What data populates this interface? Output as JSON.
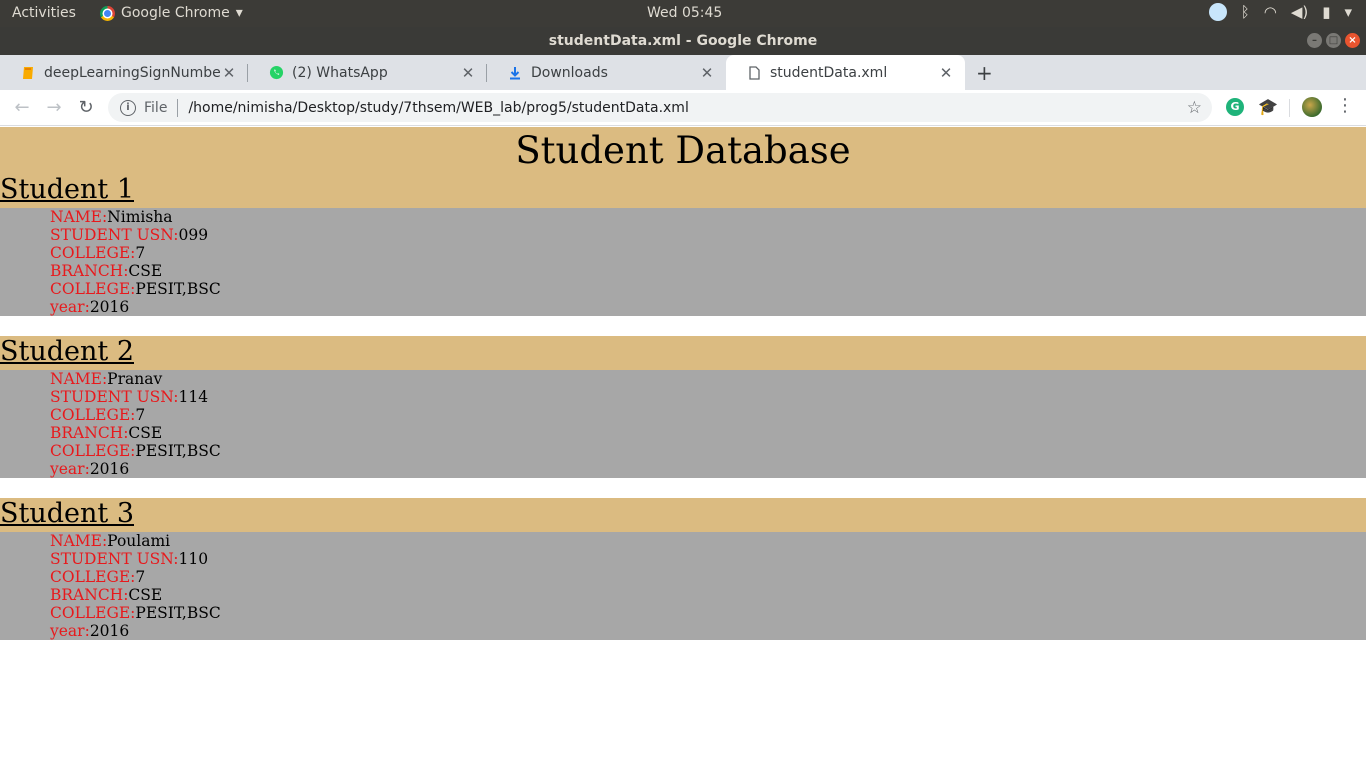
{
  "topbar": {
    "activities": "Activities",
    "app_menu": "Google Chrome",
    "clock": "Wed 05:45"
  },
  "window": {
    "title": "studentData.xml - Google Chrome"
  },
  "tabs": [
    {
      "label": "deepLearningSignNumbe",
      "icon": "colab-icon"
    },
    {
      "label": "(2) WhatsApp",
      "icon": "whatsapp-icon"
    },
    {
      "label": "Downloads",
      "icon": "download-icon"
    },
    {
      "label": "studentData.xml",
      "icon": "file-icon",
      "active": true
    }
  ],
  "toolbar": {
    "scheme_chip": "File",
    "url": "/home/nimisha/Desktop/study/7thsem/WEB_lab/prog5/studentData.xml"
  },
  "page": {
    "title": "Student Database",
    "students": [
      {
        "heading": "Student 1",
        "fields": [
          {
            "key": "NAME:",
            "value": "Nimisha"
          },
          {
            "key": "STUDENT USN:",
            "value": "099"
          },
          {
            "key": "COLLEGE:",
            "value": "7"
          },
          {
            "key": "BRANCH:",
            "value": "CSE"
          },
          {
            "key": "COLLEGE:",
            "value": "PESIT,BSC"
          },
          {
            "key": "year:",
            "value": "2016"
          }
        ]
      },
      {
        "heading": "Student 2",
        "fields": [
          {
            "key": "NAME:",
            "value": "Pranav"
          },
          {
            "key": "STUDENT USN:",
            "value": "114"
          },
          {
            "key": "COLLEGE:",
            "value": "7"
          },
          {
            "key": "BRANCH:",
            "value": "CSE"
          },
          {
            "key": "COLLEGE:",
            "value": "PESIT,BSC"
          },
          {
            "key": "year:",
            "value": "2016"
          }
        ]
      },
      {
        "heading": "Student 3",
        "fields": [
          {
            "key": "NAME:",
            "value": "Poulami"
          },
          {
            "key": "STUDENT USN:",
            "value": "110"
          },
          {
            "key": "COLLEGE:",
            "value": "7"
          },
          {
            "key": "BRANCH:",
            "value": "CSE"
          },
          {
            "key": "COLLEGE:",
            "value": "PESIT,BSC"
          },
          {
            "key": "year:",
            "value": "2016"
          }
        ]
      }
    ]
  },
  "colors": {
    "header_bg": "#dbbb81",
    "block_bg": "#a7a7a7",
    "key_text": "#e8191c"
  }
}
